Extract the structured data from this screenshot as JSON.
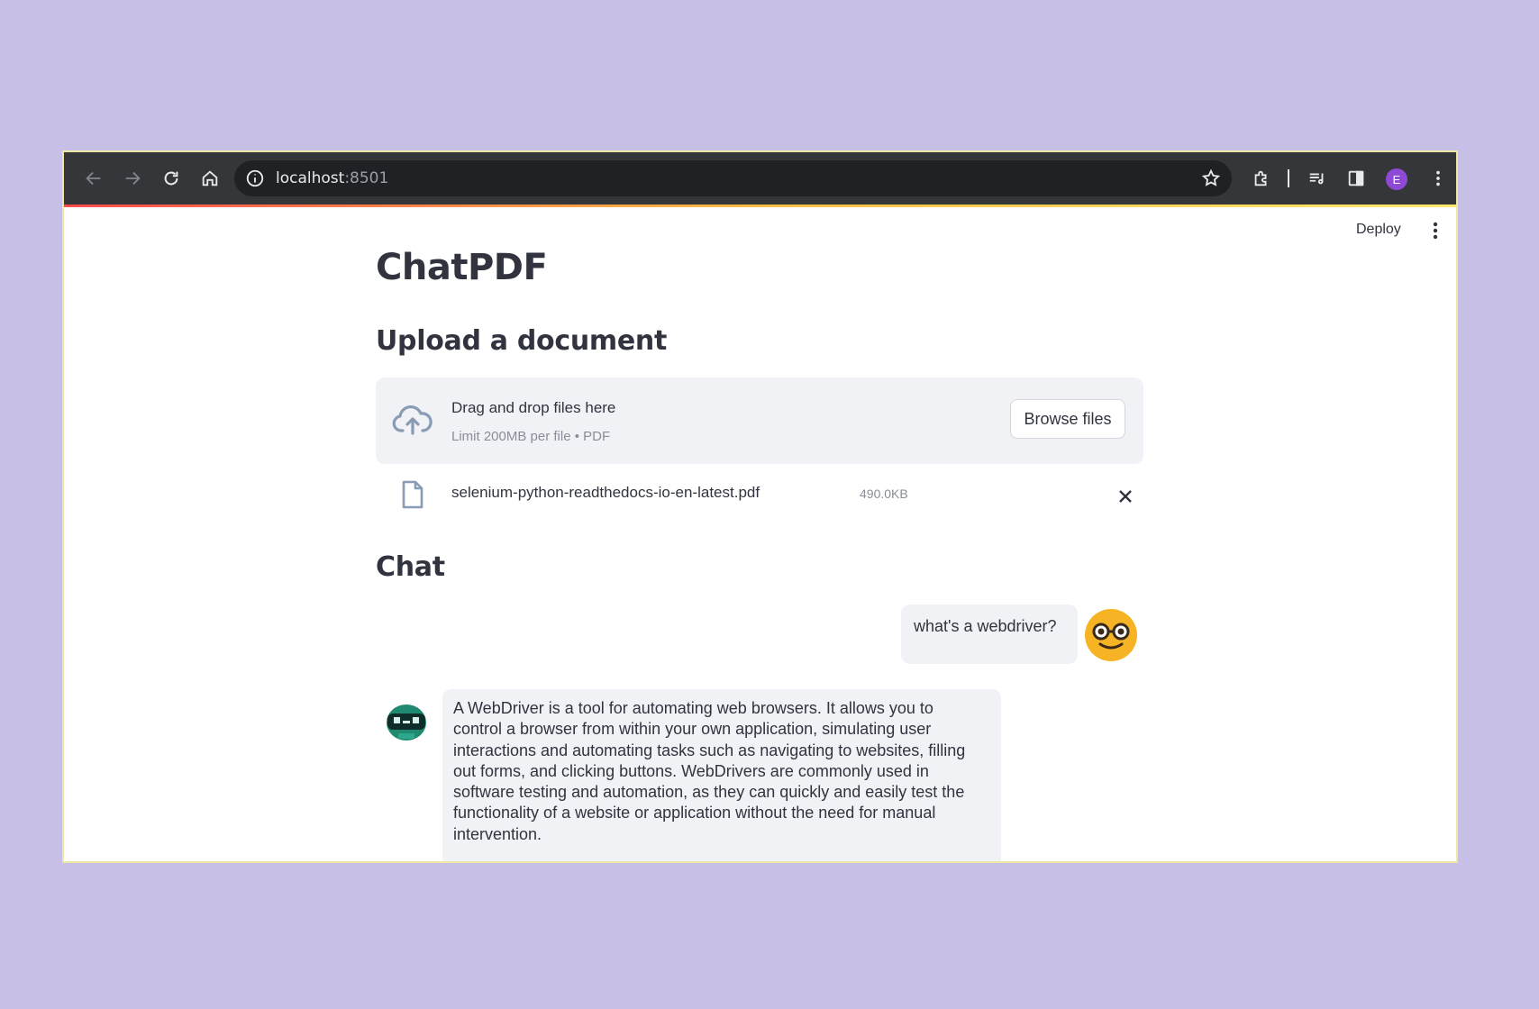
{
  "browser": {
    "url_host": "localhost",
    "url_port": ":8501",
    "profile_initial": "E"
  },
  "app": {
    "deploy_label": "Deploy",
    "title": "ChatPDF"
  },
  "upload": {
    "heading": "Upload a document",
    "dropzone_text": "Drag and drop files here",
    "dropzone_limit": "Limit 200MB per file • PDF",
    "browse_label": "Browse files",
    "file_name": "selenium-python-readthedocs-io-en-latest.pdf",
    "file_size": "490.0KB"
  },
  "chat": {
    "heading": "Chat",
    "messages": [
      {
        "role": "user",
        "text": "what's a webdriver?"
      },
      {
        "role": "assistant",
        "text": "A WebDriver is a tool for automating web browsers. It allows you to control a browser from within your own application, simulating user interactions and automating tasks such as navigating to websites, filling out forms, and clicking buttons. WebDrivers are commonly used in software testing and automation, as they can quickly and easily test the functionality of a website or application without the need for manual intervention."
      }
    ]
  },
  "colors": {
    "background": "#c8bfe6",
    "toolbar": "#35363a",
    "text": "#31333f",
    "panel": "#f0f2f6",
    "accent_gradient": [
      "#ff4b4b",
      "#ffbd45",
      "#ffe96b"
    ]
  },
  "icons": [
    "back-arrow-icon",
    "forward-arrow-icon",
    "reload-icon",
    "home-icon",
    "info-icon",
    "star-icon",
    "extensions-icon",
    "media-icon",
    "side-panel-icon",
    "kebab-menu-icon",
    "cloud-upload-icon",
    "file-icon",
    "close-icon",
    "user-avatar-icon",
    "bot-avatar-icon"
  ]
}
